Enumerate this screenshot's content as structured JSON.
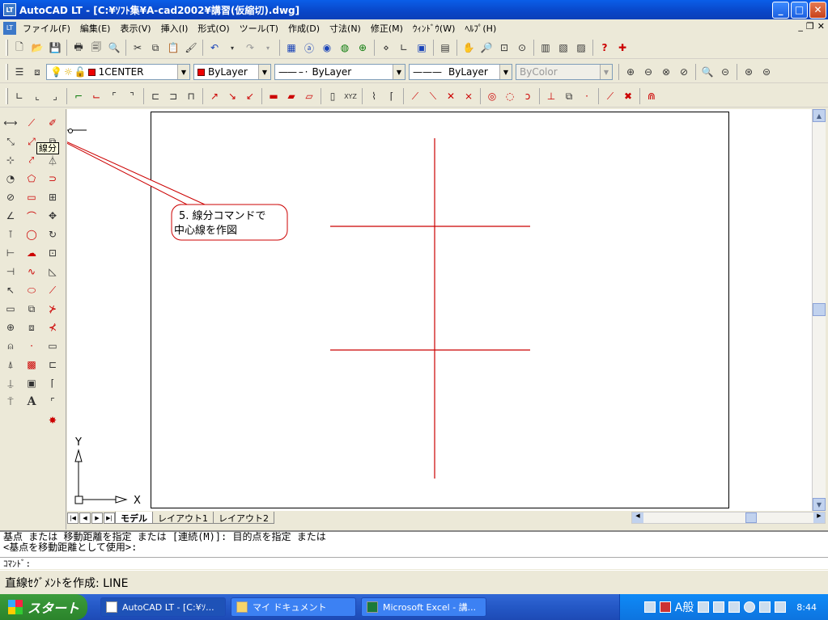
{
  "window": {
    "title": "AutoCAD LT - [C:¥ｿﾌﾄ集¥A-cad2002¥講習(仮縮切).dwg]",
    "icon": "autocad-icon"
  },
  "menu": [
    "ファイル(F)",
    "編集(E)",
    "表示(V)",
    "挿入(I)",
    "形式(O)",
    "ツール(T)",
    "作成(D)",
    "寸法(N)",
    "修正(M)",
    "ｳｨﾝﾄﾞｳ(W)",
    "ﾍﾙﾌﾟ(H)"
  ],
  "layer": {
    "name": "1CENTER",
    "color_label": "ByLayer",
    "linetype": "ByLayer",
    "lineweight": "ByLayer",
    "plotstyle": "ByColor"
  },
  "callout": {
    "line1": "5. 線分コマンドで",
    "line2": "中心線を作図"
  },
  "tooltip": "線分",
  "ucs": {
    "x": "X",
    "y": "Y"
  },
  "tabs": [
    "モデル",
    "レイアウト1",
    "レイアウト2"
  ],
  "command": {
    "line1": "基点 または 移動距離を指定 または [連続(M)]: 目的点を指定 または",
    "line2": "<基点を移動距離として使用>:",
    "prompt": "ｺﾏﾝﾄﾞ:"
  },
  "status": "直線ｾｸﾞﾒﾝﾄを作成:  LINE",
  "taskbar": {
    "start": "スタート",
    "tasks": [
      "AutoCAD LT - [C:¥ｿ...",
      "マイ ドキュメント",
      "Microsoft Excel - 講..."
    ],
    "time": "8:44",
    "ime": "A般"
  },
  "colors": {
    "centerline": "#cc0000",
    "title_blue": "#0a5ee8"
  }
}
